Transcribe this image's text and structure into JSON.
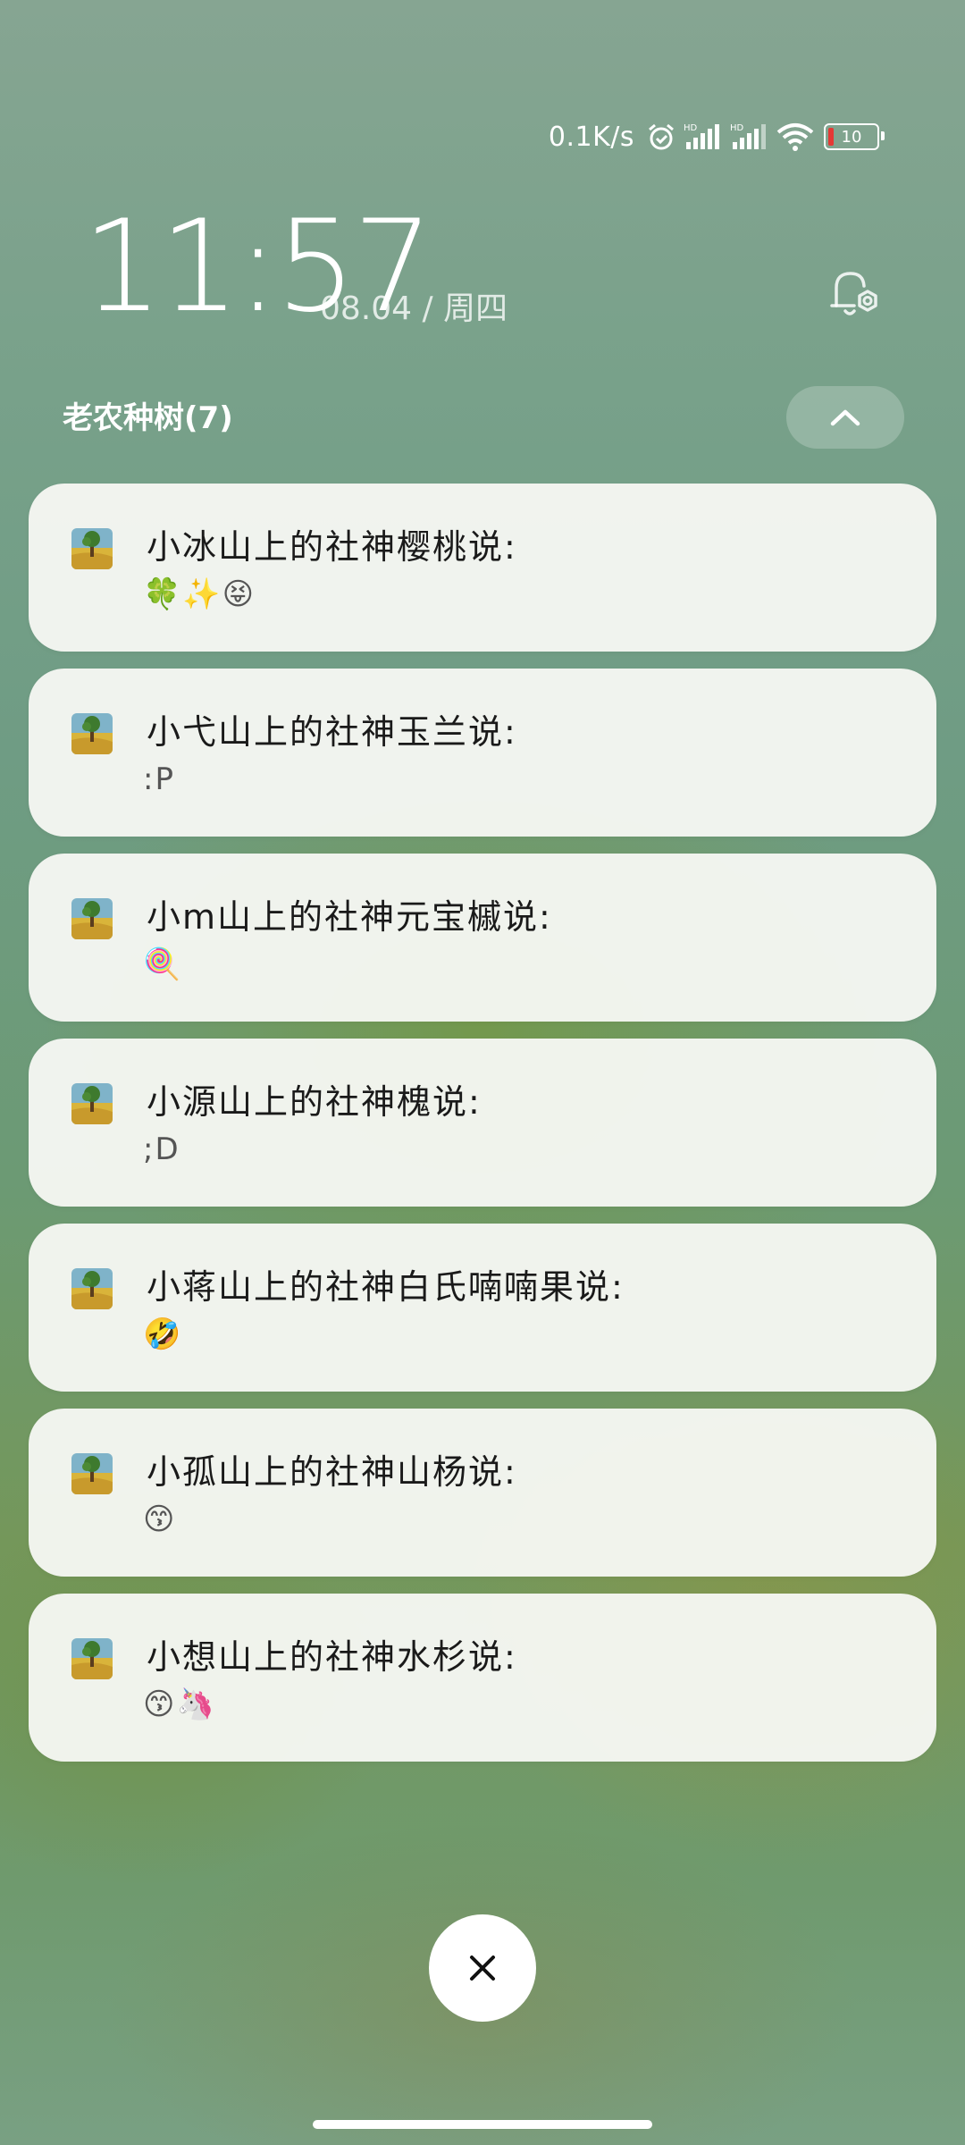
{
  "status_bar": {
    "net_speed": "0.1K/s",
    "battery_level": "10",
    "battery_color": "#e53935",
    "icons": [
      "alarm-icon",
      "hd-signal-icon-1",
      "hd-signal-icon-2",
      "wifi-icon",
      "battery-icon"
    ]
  },
  "lockscreen": {
    "time": "11:57",
    "date": "08.04 / 周四"
  },
  "group": {
    "title": "老农种树(7)"
  },
  "notifications": [
    {
      "title": "小冰山上的社神樱桃说:",
      "body": "🍀✨😝"
    },
    {
      "title": "小弋山上的社神玉兰说:",
      "body": ":P"
    },
    {
      "title": "小m山上的社神元宝槭说:",
      "body": "🍭"
    },
    {
      "title": "小源山上的社神槐说:",
      "body": ";D"
    },
    {
      "title": "小蒋山上的社神白氏喃喃果说:",
      "body": "🤣"
    },
    {
      "title": "小孤山上的社神山杨说:",
      "body": "😙"
    },
    {
      "title": "小想山上的社神水杉说:",
      "body": "😙🦄"
    }
  ]
}
